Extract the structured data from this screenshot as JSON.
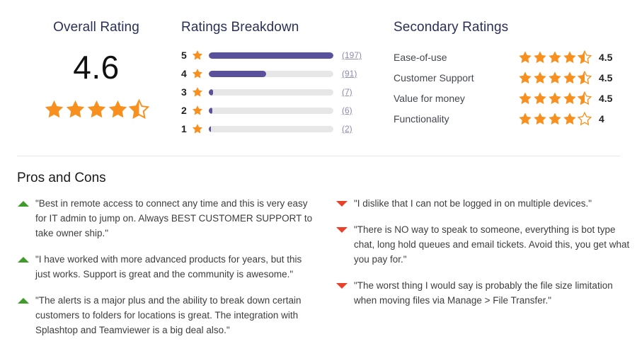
{
  "overall": {
    "title": "Overall Rating",
    "score": "4.6",
    "stars": 4.6
  },
  "breakdown": {
    "title": "Ratings Breakdown",
    "max": 197,
    "rows": [
      {
        "stars": "5",
        "count": "(197)",
        "value": 197
      },
      {
        "stars": "4",
        "count": "(91)",
        "value": 91
      },
      {
        "stars": "3",
        "count": "(7)",
        "value": 7
      },
      {
        "stars": "2",
        "count": "(6)",
        "value": 6
      },
      {
        "stars": "1",
        "count": "(2)",
        "value": 2
      }
    ]
  },
  "secondary": {
    "title": "Secondary Ratings",
    "rows": [
      {
        "label": "Ease-of-use",
        "value": "4.5",
        "stars": 4.5
      },
      {
        "label": "Customer Support",
        "value": "4.5",
        "stars": 4.5
      },
      {
        "label": "Value for money",
        "value": "4.5",
        "stars": 4.5
      },
      {
        "label": "Functionality",
        "value": "4",
        "stars": 4
      }
    ]
  },
  "pros_cons": {
    "title": "Pros and Cons",
    "pros": [
      "\"Best in remote access to connect any time and this is very easy for IT admin to jump on. Always BEST CUSTOMER SUPPORT to take owner ship.\"",
      "\"I have worked with more advanced products for years, but this just works. Support is great and the community is awesome.\"",
      "\"The alerts is a major plus and the ability to break down certain customers to folders for locations is great. The integration with Splashtop and Teamviewer is a big deal also.\""
    ],
    "cons": [
      "\"I dislike that I can not be logged in on multiple devices.\"",
      "\"There is NO way to speak to someone, everything is bot type chat, long hold queues and email tickets. Avoid this, you get what you pay for.\"",
      "\"The worst thing I would say is probably the file size limitation when moving files via Manage > File Transfer.\""
    ]
  },
  "colors": {
    "star": "#f7901e",
    "bar_fill": "#59519b",
    "bar_track": "#e7e7e7",
    "heading": "#2b3057",
    "pro": "#3f9c2b",
    "con": "#e8412a"
  }
}
